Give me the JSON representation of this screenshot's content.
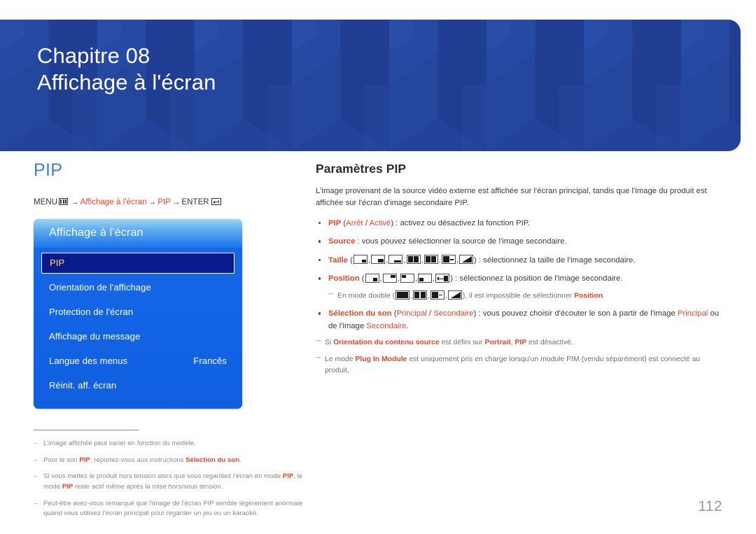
{
  "chapter": {
    "number_label": "Chapitre 08",
    "title": "Affichage à l'écran"
  },
  "left": {
    "section_title": "PIP",
    "menu_path": {
      "menu_label": "MENU",
      "menu_icon": "menu-bars-icon",
      "arrow": "→",
      "step1": "Affichage à l'écran",
      "step2": "PIP",
      "enter_label": "ENTER",
      "enter_icon": "enter-return-icon"
    },
    "osd_panel": {
      "header_title": "Affichage à l'écran",
      "rows": [
        {
          "label": "PIP",
          "value": "",
          "selected": true
        },
        {
          "label": "Orientation de l'affichage",
          "value": "",
          "selected": false
        },
        {
          "label": "Protection de l'écran",
          "value": "",
          "selected": false
        },
        {
          "label": "Affichage du message",
          "value": "",
          "selected": false
        },
        {
          "label": "Langue des menus",
          "value": "Francês",
          "selected": false
        },
        {
          "label": "Réinit. aff. écran",
          "value": "",
          "selected": false
        }
      ]
    },
    "notes": [
      {
        "dash": "–",
        "parts": [
          {
            "t": "L'image affichée peut varier en fonction du modèle.",
            "s": "n"
          }
        ]
      },
      {
        "dash": "–",
        "parts": [
          {
            "t": "Pour le son ",
            "s": "n"
          },
          {
            "t": "PIP",
            "s": "b"
          },
          {
            "t": ", reportez-vous aux instructions ",
            "s": "n"
          },
          {
            "t": "Sélection du son",
            "s": "b"
          },
          {
            "t": ".",
            "s": "n"
          }
        ]
      },
      {
        "dash": "–",
        "parts": [
          {
            "t": "Si vous mettez le produit hors tension alors que vous regardiez l'écran en mode ",
            "s": "n"
          },
          {
            "t": "PIP",
            "s": "b"
          },
          {
            "t": ", le mode ",
            "s": "n"
          },
          {
            "t": "PIP",
            "s": "b"
          },
          {
            "t": " reste actif même après la mise hors/sous tension.",
            "s": "n"
          }
        ]
      },
      {
        "dash": "–",
        "parts": [
          {
            "t": "Peut-être avez-vous remarqué que l'image de l'écran PIP semble légèrement anormale quand vous utilisez l'écran principal pour regarder un jeu ou un karaoké.",
            "s": "n"
          }
        ]
      }
    ]
  },
  "right": {
    "sub_title": "Paramètres PIP",
    "intro": "L'image provenant de la source vidéo externe est affichée sur l'écran principal, tandis que l'image du produit est affichée sur l'écran d'image secondaire PIP.",
    "bullets": [
      {
        "id": "pip",
        "parts": [
          {
            "t": "PIP",
            "s": "b"
          },
          {
            "t": " (",
            "s": "n"
          },
          {
            "t": "Arrêt",
            "s": "h"
          },
          {
            "t": " / ",
            "s": "n"
          },
          {
            "t": "Activé",
            "s": "h"
          },
          {
            "t": ") : activez ou désactivez la fonction PIP.",
            "s": "n"
          }
        ]
      },
      {
        "id": "source",
        "parts": [
          {
            "t": "Source",
            "s": "b"
          },
          {
            "t": " : vous pouvez sélectionner la source de l'image secondaire.",
            "s": "n"
          }
        ]
      },
      {
        "id": "taille",
        "label": "Taille",
        "prefix": " (",
        "icons": [
          "pip-size-small",
          "pip-size-medium",
          "pip-size-wide",
          "pip-double-half",
          "pip-double-quad",
          "pip-double-bar",
          "pip-double-diag"
        ],
        "suffix": ") : sélectionnez la taille de l'image secondaire."
      },
      {
        "id": "position",
        "label": "Position",
        "prefix": " (",
        "icons": [
          "pip-pos-bottom-right",
          "pip-pos-top-right",
          "pip-pos-top-left",
          "pip-pos-bottom-left",
          "pip-pos-move"
        ],
        "suffix": ") : sélectionnez la position de l'image secondaire."
      },
      {
        "id": "son",
        "parts": [
          {
            "t": "Sélection du son",
            "s": "b"
          },
          {
            "t": " (",
            "s": "n"
          },
          {
            "t": "Principal",
            "s": "h"
          },
          {
            "t": " / ",
            "s": "n"
          },
          {
            "t": "Secondaire",
            "s": "h"
          },
          {
            "t": ") : vous pouvez choisir d'écouter le son à partir de l'image ",
            "s": "n"
          },
          {
            "t": "Principal",
            "s": "h"
          },
          {
            "t": " ou de l'image ",
            "s": "n"
          },
          {
            "t": "Secondaire",
            "s": "h"
          },
          {
            "t": ".",
            "s": "n"
          }
        ]
      }
    ],
    "subnote_double": {
      "dash": "─",
      "before": "En mode double (",
      "icons": [
        "pip-double-half",
        "pip-double-quad",
        "pip-double-bar",
        "pip-double-diag"
      ],
      "middle": "), il est impossible de sélectionner ",
      "highlight": "Position",
      "after": "."
    },
    "subnotes": [
      {
        "dash": "─",
        "parts": [
          {
            "t": "Si ",
            "s": "n"
          },
          {
            "t": "Orientation du contenu source",
            "s": "b"
          },
          {
            "t": " est défini sur ",
            "s": "n"
          },
          {
            "t": "Portrait",
            "s": "b"
          },
          {
            "t": ", ",
            "s": "n"
          },
          {
            "t": "PIP",
            "s": "b"
          },
          {
            "t": " est désactivé.",
            "s": "n"
          }
        ]
      },
      {
        "dash": "─",
        "parts": [
          {
            "t": "Le mode ",
            "s": "n"
          },
          {
            "t": "Plug In Module",
            "s": "b"
          },
          {
            "t": " est uniquement pris en charge lorsqu'un module PIM (vendu séparément) est connecté au produit.",
            "s": "n"
          }
        ]
      }
    ]
  },
  "page_number": "112",
  "colors": {
    "banner_blue": "#22429b",
    "section_title_blue": "#3e7ed0",
    "accent_orange": "#e8442a",
    "osd_blue": "#1668e9",
    "osd_selected": "#0a1a8c",
    "osd_selected_text": "#ffe15c",
    "note_gray": "#8a8a8a",
    "page_number_gray": "#9a9a9a"
  }
}
